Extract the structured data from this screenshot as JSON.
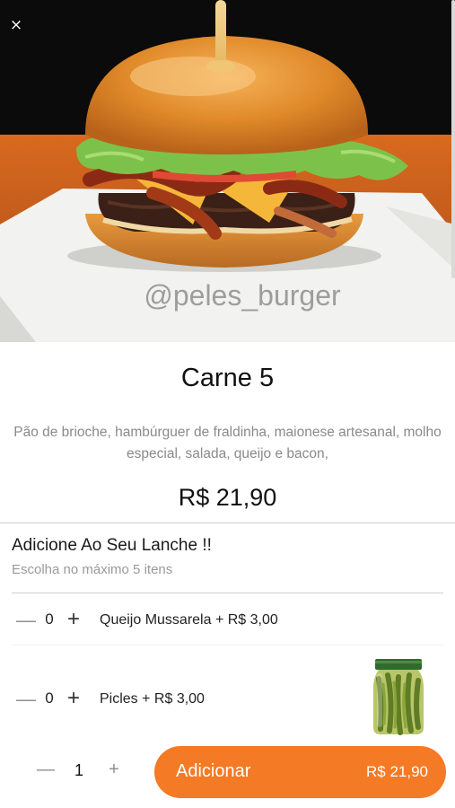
{
  "product": {
    "image_watermark": "@peles_burger",
    "name": "Carne 5",
    "description": "Pão de brioche, hambúrguer de fraldinha, maionese artesanal, molho especial, salada, queijo e bacon,",
    "price": "R$ 21,90"
  },
  "header": {
    "close_icon": "×"
  },
  "addons": {
    "title": "Adicione Ao Seu Lanche !!",
    "subtitle": "Escolha no máximo 5 itens",
    "items": [
      {
        "label": "Queijo Mussarela + R$ 3,00",
        "quantity": "0",
        "minus": "—",
        "plus": "+"
      },
      {
        "label": "Picles + R$ 3,00",
        "quantity": "0",
        "minus": "—",
        "plus": "+",
        "thumbnail": "pickle-jar"
      }
    ]
  },
  "footer": {
    "minus": "—",
    "quantity": "1",
    "plus": "+",
    "add_label": "Adicionar",
    "add_price": "R$ 21,90"
  },
  "colors": {
    "accent": "#f47a26",
    "muted_text": "#8a8a8a",
    "divider": "#cfcfcf"
  }
}
